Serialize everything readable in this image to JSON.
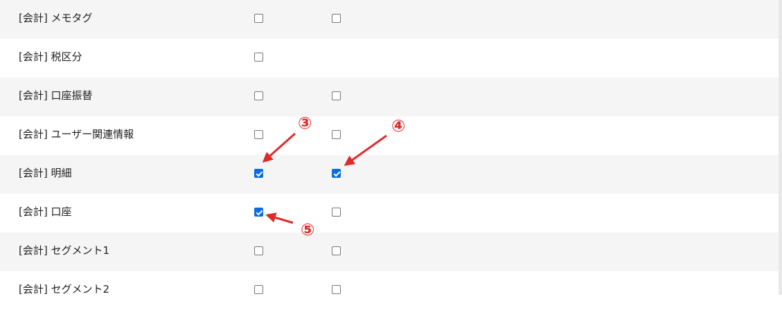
{
  "rows": [
    {
      "label": "[会計] メモタグ",
      "col1": false,
      "col2": false
    },
    {
      "label": "[会計] 税区分",
      "col1": false
    },
    {
      "label": "[会計] 口座振替",
      "col1": false,
      "col2": false
    },
    {
      "label": "[会計] ユーザー関連情報",
      "col1": false,
      "col2": false
    },
    {
      "label": "[会計] 明細",
      "col1": true,
      "col2": true
    },
    {
      "label": "[会計] 口座",
      "col1": true,
      "col2": false
    },
    {
      "label": "[会計] セグメント1",
      "col1": false,
      "col2": false
    },
    {
      "label": "[会計] セグメント2",
      "col1": false,
      "col2": false
    }
  ],
  "annotations": {
    "marker_3": "③",
    "marker_4": "④",
    "marker_5": "⑤",
    "color": "#e02a2a"
  },
  "colors": {
    "row_shaded": "#f5f5f5",
    "row_white": "#ffffff",
    "checkbox_checked": "#0b6ce5"
  }
}
